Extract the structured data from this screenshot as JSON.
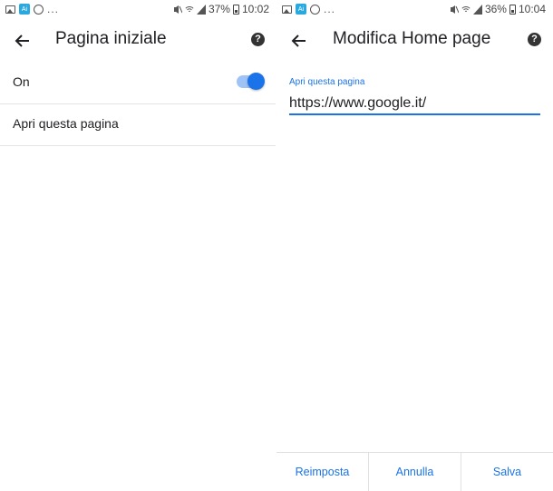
{
  "left": {
    "status": {
      "app_icon_text": "Ai",
      "ellipsis": "...",
      "battery": "37%",
      "time": "10:02"
    },
    "title": "Pagina iniziale",
    "toggle_row_label": "On",
    "toggle_state": "on",
    "page_row_label": "Apri questa pagina"
  },
  "right": {
    "status": {
      "app_icon_text": "Ai",
      "ellipsis": "...",
      "battery": "36%",
      "time": "10:04"
    },
    "title": "Modifica Home page",
    "field_label": "Apri questa pagina",
    "field_value": "https://www.google.it/",
    "buttons": {
      "reset": "Reimposta",
      "cancel": "Annulla",
      "save": "Salva"
    }
  },
  "colors": {
    "accent": "#1a73e8",
    "toggle_track": "#9ec3f7",
    "text": "#202124"
  },
  "icons": [
    "back-arrow-icon",
    "help-icon",
    "image-icon",
    "face-icon",
    "mute-icon",
    "wifi-icon",
    "signal-icon",
    "battery-icon"
  ]
}
